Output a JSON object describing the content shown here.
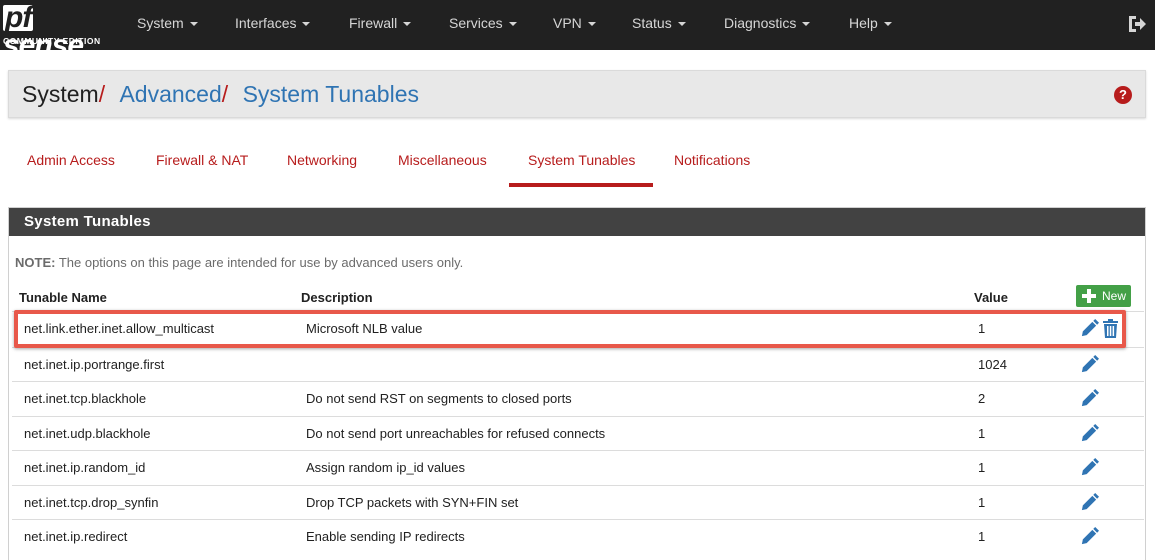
{
  "logo": {
    "main": "sense",
    "prefix": "pf",
    "sub": "COMMUNITY EDITION"
  },
  "nav": [
    {
      "label": "System"
    },
    {
      "label": "Interfaces"
    },
    {
      "label": "Firewall"
    },
    {
      "label": "Services"
    },
    {
      "label": "VPN"
    },
    {
      "label": "Status"
    },
    {
      "label": "Diagnostics"
    },
    {
      "label": "Help"
    }
  ],
  "breadcrumb": {
    "home": "System",
    "sep": "/",
    "level2": "Advanced",
    "level3": "System Tunables"
  },
  "help_icon": "question-circle-icon",
  "tabs": [
    {
      "label": "Admin Access"
    },
    {
      "label": "Firewall & NAT"
    },
    {
      "label": "Networking"
    },
    {
      "label": "Miscellaneous"
    },
    {
      "label": "System Tunables",
      "active": true
    },
    {
      "label": "Notifications"
    }
  ],
  "panel": {
    "title": "System Tunables",
    "note_label": "NOTE:",
    "note_text": " The options on this page are intended for use by advanced users only.",
    "columns": {
      "name": "Tunable Name",
      "description": "Description",
      "value": "Value"
    },
    "new_button": "New",
    "rows": [
      {
        "name": "net.link.ether.inet.allow_multicast",
        "description": "Microsoft NLB value",
        "value": "1",
        "deletable": true
      },
      {
        "name": "net.inet.ip.portrange.first",
        "description": "",
        "value": "1024"
      },
      {
        "name": "net.inet.tcp.blackhole",
        "description": "Do not send RST on segments to closed ports",
        "value": "2"
      },
      {
        "name": "net.inet.udp.blackhole",
        "description": "Do not send port unreachables for refused connects",
        "value": "1"
      },
      {
        "name": "net.inet.ip.random_id",
        "description": "Assign random ip_id values",
        "value": "1"
      },
      {
        "name": "net.inet.tcp.drop_synfin",
        "description": "Drop TCP packets with SYN+FIN set",
        "value": "1"
      },
      {
        "name": "net.inet.ip.redirect",
        "description": "Enable sending IP redirects",
        "value": "1"
      }
    ]
  },
  "colors": {
    "brand_red": "#b71c1c",
    "link_blue": "#2f74b3",
    "navbar": "#212121",
    "highlight": "#e8584a",
    "new_green": "#43a047"
  }
}
